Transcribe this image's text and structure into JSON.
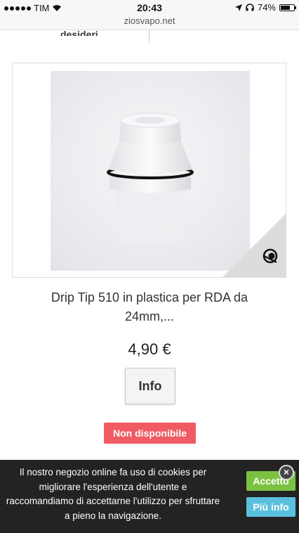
{
  "status_bar": {
    "carrier": "TIM",
    "time": "20:43",
    "battery": "74%",
    "battery_level": 0.74
  },
  "browser": {
    "url": "ziosvapo.net"
  },
  "above_label": "desideri",
  "product": {
    "name": "Drip Tip 510 in plastica per RDA da 24mm,...",
    "price": "4,90 €",
    "info_label": "Info",
    "availability": "Non disponibile"
  },
  "cookie_banner": {
    "message": "Il nostro negozio online fa uso di cookies per migliorare l'esperienza dell'utente e raccomandiamo di accettarne l'utilizzo per sfruttare a pieno la navigazione.",
    "accept_label": "Accetto",
    "more_info_label": "Più info",
    "close_label": "×"
  },
  "colors": {
    "availability": "#f05a63",
    "accept": "#7cc242",
    "more_info": "#5bc0de"
  },
  "icons": [
    "signal-dots-icon",
    "wifi-icon",
    "location-arrow-icon",
    "headphones-icon",
    "battery-icon",
    "quickview-eye-icon",
    "close-icon"
  ]
}
